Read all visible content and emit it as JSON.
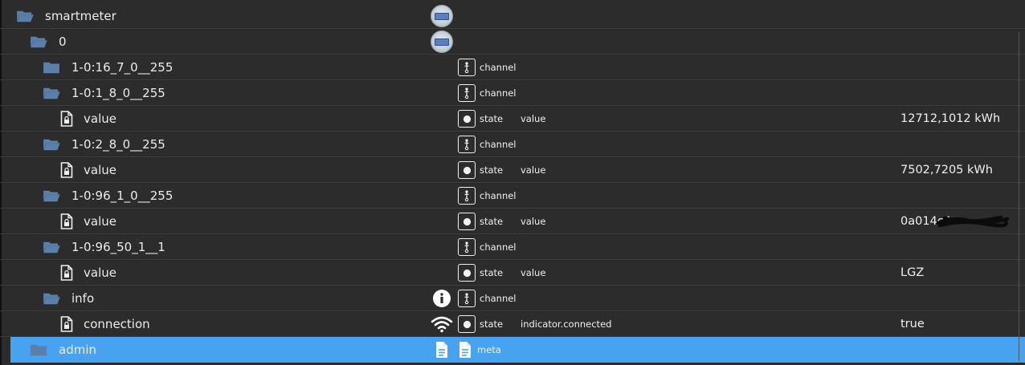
{
  "tree": {
    "rows": [
      {
        "name": "smartmeter",
        "kind": "folder",
        "level": 0,
        "icon": "meter-image-icon",
        "type": "",
        "role": "",
        "value": ""
      },
      {
        "name": "0",
        "kind": "folder",
        "level": 1,
        "icon": "meter-image-icon",
        "type": "",
        "role": "",
        "value": ""
      },
      {
        "name": "1-0:16_7_0__255",
        "kind": "folder-closed",
        "level": 2,
        "icon": "",
        "type": "channel",
        "role": "",
        "value": ""
      },
      {
        "name": "1-0:1_8_0__255",
        "kind": "folder",
        "level": 2,
        "icon": "",
        "type": "channel",
        "role": "",
        "value": ""
      },
      {
        "name": "value",
        "kind": "file",
        "level": 3,
        "icon": "",
        "type": "state",
        "role": "value",
        "value": "12712,1012 kWh"
      },
      {
        "name": "1-0:2_8_0__255",
        "kind": "folder",
        "level": 2,
        "icon": "",
        "type": "channel",
        "role": "",
        "value": ""
      },
      {
        "name": "value",
        "kind": "file",
        "level": 3,
        "icon": "",
        "type": "state",
        "role": "value",
        "value": "7502,7205 kWh"
      },
      {
        "name": "1-0:96_1_0__255",
        "kind": "folder",
        "level": 2,
        "icon": "",
        "type": "channel",
        "role": "",
        "value": ""
      },
      {
        "name": "value",
        "kind": "file",
        "level": 3,
        "icon": "",
        "type": "state",
        "role": "value",
        "value": "0a014c4"
      },
      {
        "name": "1-0:96_50_1__1",
        "kind": "folder",
        "level": 2,
        "icon": "",
        "type": "channel",
        "role": "",
        "value": ""
      },
      {
        "name": "value",
        "kind": "file",
        "level": 3,
        "icon": "",
        "type": "state",
        "role": "value",
        "value": "LGZ"
      },
      {
        "name": "info",
        "kind": "folder",
        "level": 2,
        "icon": "info-icon",
        "type": "channel",
        "role": "",
        "value": ""
      },
      {
        "name": "connection",
        "kind": "file",
        "level": 3,
        "icon": "wifi-icon",
        "type": "state",
        "role": "indicator.connected",
        "value": "true"
      },
      {
        "name": "admin",
        "kind": "folder-closed",
        "level": 1,
        "icon": "document-icon",
        "type": "meta",
        "role": "",
        "value": "",
        "selected": true
      }
    ]
  },
  "colors": {
    "background": "#2c2c2c",
    "selected_row": "#47a3f0",
    "folder_icon": "#5b7fa8"
  }
}
